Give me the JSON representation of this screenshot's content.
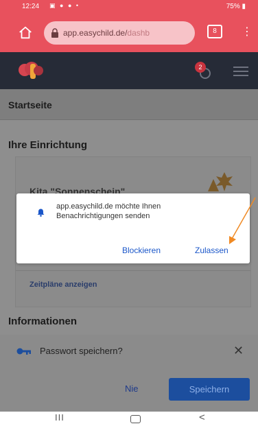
{
  "statusbar": {
    "time": "12:24",
    "icons": "▣ ● ● •",
    "battery": "75% ▮"
  },
  "browser": {
    "url_host": "app.easychild.de/",
    "url_path": "dashb",
    "tabs_count": "8"
  },
  "app": {
    "notification_count": "2"
  },
  "page": {
    "title": "Startseite",
    "facility_heading": "Ihre Einrichtung",
    "facility_name": "Kita \"Sonnenschein\"",
    "schedule_link": "Zeitpläne anzeigen",
    "info_heading": "Informationen"
  },
  "password_prompt": {
    "text": "Passwort speichern?",
    "close": "✕",
    "never": "Nie",
    "save": "Speichern"
  },
  "notification_dialog": {
    "message": "app.easychild.de möchte Ihnen Benachrichtigungen senden",
    "block": "Blockieren",
    "allow": "Zulassen"
  },
  "android_nav": {
    "recents": "III",
    "back": "<"
  },
  "colors": {
    "browser_bar": "#e8515d",
    "app_nav": "#262b37",
    "link_blue": "#1a56c9",
    "annotation": "#f08a24"
  }
}
